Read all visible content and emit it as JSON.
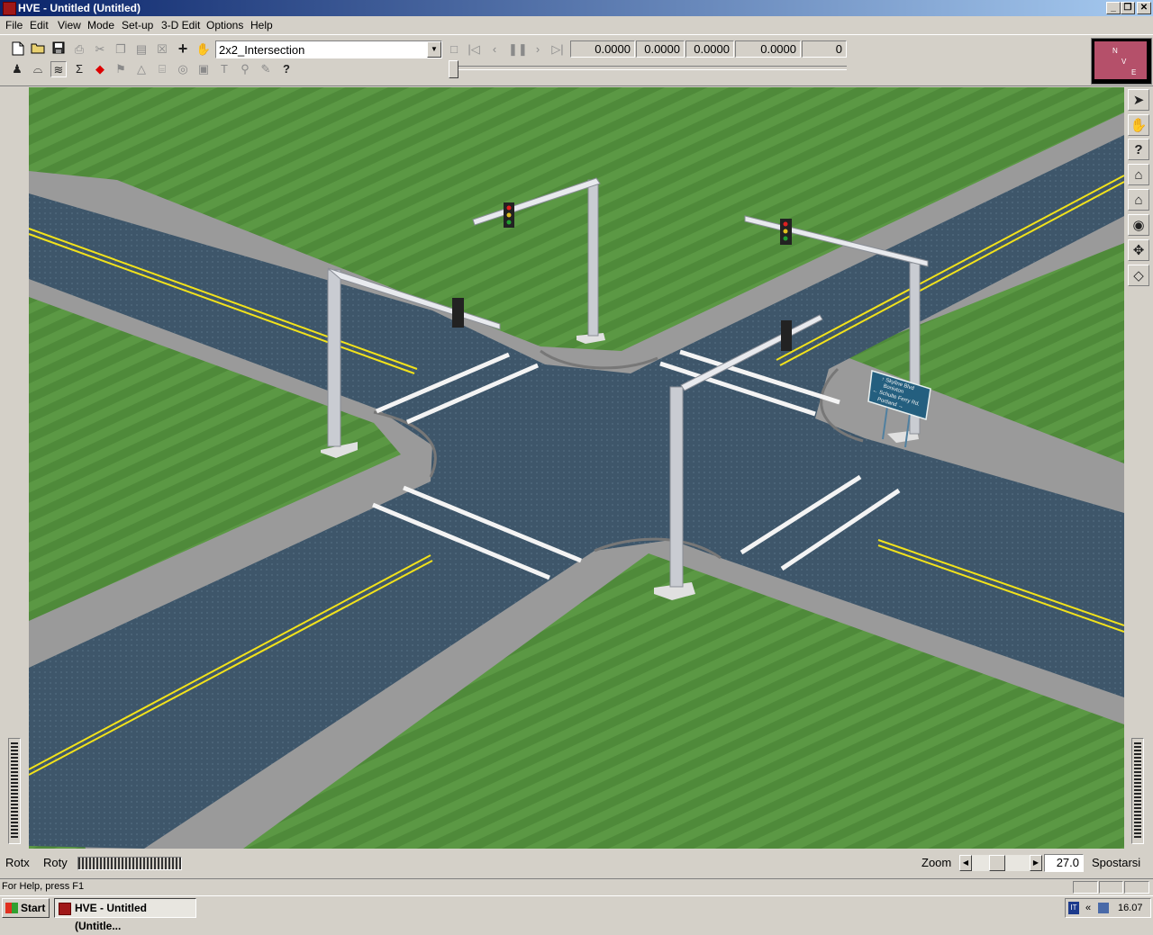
{
  "window": {
    "title": "HVE - Untitled (Untitled)",
    "controls": {
      "minimize": "_",
      "restore": "❐",
      "close": "✕"
    }
  },
  "menu": [
    "File",
    "Edit",
    "View",
    "Mode",
    "Set-up",
    "3-D Edit",
    "Options",
    "Help"
  ],
  "toolbar": {
    "top_icons": [
      "new-file-icon",
      "open-folder-icon",
      "save-icon",
      "print-icon",
      "cut-icon",
      "copy-icon",
      "paste-icon",
      "delete-icon",
      "add-icon",
      "hand-icon"
    ],
    "bottom_icons": [
      "event-icon",
      "vehicle-icon",
      "environment-icon",
      "sigma-icon",
      "red-arrows-icon",
      "flag-icon",
      "cone-icon",
      "cylinder-icon",
      "target-icon",
      "box-icon",
      "t-icon",
      "pin-icon",
      "tool-icon",
      "help-icon"
    ],
    "environment_select": "2x2_Intersection",
    "playback_icons": [
      "stop-icon",
      "rewind-icon",
      "step-back-icon",
      "pause-icon",
      "step-forward-icon",
      "end-icon"
    ],
    "readouts": [
      "0.0000",
      "0.0000",
      "0.0000",
      "0.0000",
      "0"
    ]
  },
  "compass": {
    "labels": [
      "N",
      "V",
      "E"
    ]
  },
  "viewport": {
    "sign_lines": [
      "↑ Skyline Blvd",
      "Bonivton",
      "← Schulte Ferry Rd.",
      "Portland →"
    ],
    "colors": {
      "grass": "#4f8a3a",
      "road": "#3d5568",
      "curb": "#9a9a9a",
      "stripe": "#f2e21b"
    }
  },
  "right_toolbar": [
    "pointer-icon",
    "pan-hand-icon",
    "question-icon",
    "home-icon",
    "home-edit-icon",
    "eye-icon",
    "move-icon",
    "cube-icon"
  ],
  "controls": {
    "rotx_label": "Rotx",
    "roty_label": "Roty",
    "zoom_label": "Zoom",
    "zoom_value": "27.0",
    "pan_label": "Spostarsi"
  },
  "status": {
    "help": "For Help, press F1"
  },
  "taskbar": {
    "start": "Start",
    "task_item": "HVE - Untitled (Untitle...",
    "tray_lang": "IT",
    "tray_chevron": "«",
    "clock": "16.07"
  }
}
